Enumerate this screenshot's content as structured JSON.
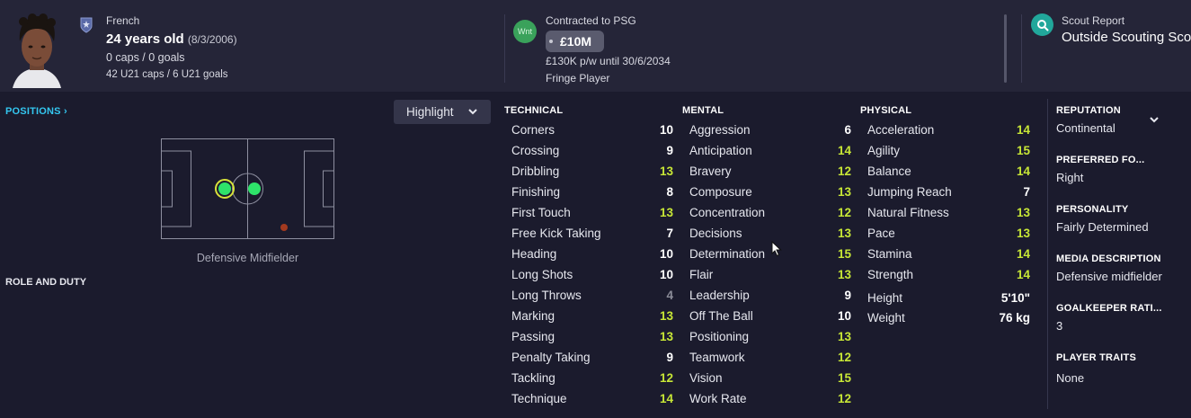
{
  "header": {
    "nationality": "French",
    "age": "24 years old",
    "dob": "(8/3/2006)",
    "caps": "0 caps / 0 goals",
    "u21": "42 U21 caps / 6 U21 goals",
    "transfer_badge": "Wnt",
    "contract": "Contracted to PSG",
    "value": "£10M",
    "wage": "£130K p/w until 30/6/2034",
    "squad_status": "Fringe Player",
    "scout_title": "Scout Report",
    "scout_sub": "Outside Scouting Sco"
  },
  "left": {
    "positions_label": "POSITIONS ›",
    "highlight_label": "Highlight",
    "position_caption": "Defensive Midfielder",
    "role_label": "ROLE AND DUTY"
  },
  "technical": {
    "title": "TECHNICAL",
    "items": [
      {
        "name": "Corners",
        "value": "10"
      },
      {
        "name": "Crossing",
        "value": "9"
      },
      {
        "name": "Dribbling",
        "value": "13"
      },
      {
        "name": "Finishing",
        "value": "8"
      },
      {
        "name": "First Touch",
        "value": "13"
      },
      {
        "name": "Free Kick Taking",
        "value": "7"
      },
      {
        "name": "Heading",
        "value": "10"
      },
      {
        "name": "Long Shots",
        "value": "10"
      },
      {
        "name": "Long Throws",
        "value": "4"
      },
      {
        "name": "Marking",
        "value": "13"
      },
      {
        "name": "Passing",
        "value": "13"
      },
      {
        "name": "Penalty Taking",
        "value": "9"
      },
      {
        "name": "Tackling",
        "value": "12"
      },
      {
        "name": "Technique",
        "value": "14"
      }
    ]
  },
  "mental": {
    "title": "MENTAL",
    "items": [
      {
        "name": "Aggression",
        "value": "6"
      },
      {
        "name": "Anticipation",
        "value": "14"
      },
      {
        "name": "Bravery",
        "value": "12"
      },
      {
        "name": "Composure",
        "value": "13"
      },
      {
        "name": "Concentration",
        "value": "12"
      },
      {
        "name": "Decisions",
        "value": "13"
      },
      {
        "name": "Determination",
        "value": "15"
      },
      {
        "name": "Flair",
        "value": "13"
      },
      {
        "name": "Leadership",
        "value": "9"
      },
      {
        "name": "Off The Ball",
        "value": "10"
      },
      {
        "name": "Positioning",
        "value": "13"
      },
      {
        "name": "Teamwork",
        "value": "12"
      },
      {
        "name": "Vision",
        "value": "15"
      },
      {
        "name": "Work Rate",
        "value": "12"
      }
    ]
  },
  "physical": {
    "title": "PHYSICAL",
    "items": [
      {
        "name": "Acceleration",
        "value": "14"
      },
      {
        "name": "Agility",
        "value": "15"
      },
      {
        "name": "Balance",
        "value": "14"
      },
      {
        "name": "Jumping Reach",
        "value": "7"
      },
      {
        "name": "Natural Fitness",
        "value": "13"
      },
      {
        "name": "Pace",
        "value": "13"
      },
      {
        "name": "Stamina",
        "value": "14"
      },
      {
        "name": "Strength",
        "value": "14"
      }
    ],
    "height_label": "Height",
    "height": "5'10\"",
    "weight_label": "Weight",
    "weight": "76 kg"
  },
  "info": {
    "reputation_label": "REPUTATION",
    "reputation": "Continental",
    "foot_label": "PREFERRED FO...",
    "foot": "Right",
    "personality_label": "PERSONALITY",
    "personality": "Fairly Determined",
    "media_label": "MEDIA DESCRIPTION",
    "media": "Defensive midfielder",
    "gk_label": "GOALKEEPER RATI...",
    "gk": "3",
    "traits_label": "PLAYER TRAITS",
    "traits": "None"
  },
  "colors": {
    "background": "#1b1b2d",
    "header": "#252538",
    "good_attribute": "#c7e636",
    "weak_attribute": "#8c8d99",
    "link": "#34c7f0",
    "scout_accent": "#21a79b"
  }
}
